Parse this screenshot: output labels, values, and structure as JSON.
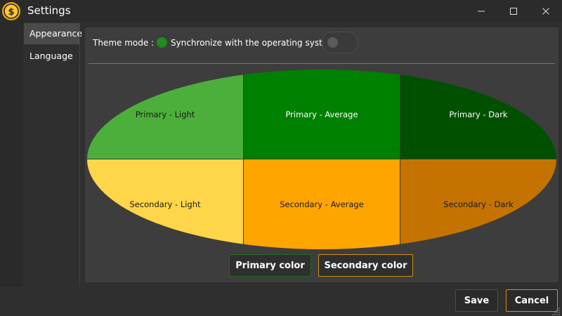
{
  "window": {
    "title": "Settings",
    "app_icon": "coin-dollar-icon",
    "controls": [
      "minimize-icon",
      "maximize-icon",
      "close-icon"
    ]
  },
  "sidebar": {
    "items": [
      {
        "label": "Appearance",
        "active": true
      },
      {
        "label": "Language",
        "active": false
      }
    ]
  },
  "appearance": {
    "theme_mode_label": "Theme mode :",
    "sync_label": "Synchronize with the operating system",
    "sync_toggle_on": false,
    "swatches": [
      {
        "label": "Primary - Light",
        "color": "#4caf3c",
        "text_color": "#1a1a1a"
      },
      {
        "label": "Primary - Average",
        "color": "#008000",
        "text_color": "#ffffff"
      },
      {
        "label": "Primary - Dark",
        "color": "#005000",
        "text_color": "#ffffff"
      },
      {
        "label": "Secondary - Light",
        "color": "#ffd54a",
        "text_color": "#1a1a1a"
      },
      {
        "label": "Secondary - Average",
        "color": "#ffa500",
        "text_color": "#1a1a1a"
      },
      {
        "label": "Secondary - Dark",
        "color": "#c47300",
        "text_color": "#1a1a1a"
      }
    ],
    "primary_color_button": "Primary color",
    "secondary_color_button": "Secondary color"
  },
  "footer": {
    "save_label": "Save",
    "cancel_label": "Cancel"
  },
  "colors": {
    "primary_accent": "#1b6e1b",
    "secondary_accent": "#d4900c",
    "window_bg": "#2f2f2f",
    "panel_bg": "#3d3d3d"
  }
}
